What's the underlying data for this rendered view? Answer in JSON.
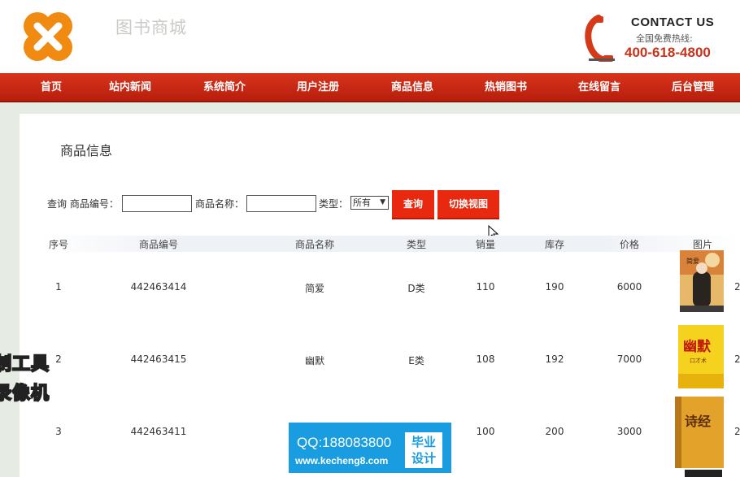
{
  "header": {
    "site_title": "图书商城",
    "contact_title": "CONTACT US",
    "contact_sub": "全国免费热线:",
    "contact_phone": "400-618-4800"
  },
  "nav": {
    "items": [
      "首页",
      "站内新闻",
      "系统简介",
      "用户注册",
      "商品信息",
      "热销图书",
      "在线留言",
      "后台管理"
    ]
  },
  "page": {
    "title": "商品信息"
  },
  "search": {
    "prefix_label": "查询 商品编号：",
    "code_value": "",
    "name_label": "商品名称：",
    "name_value": "",
    "type_label": "类型：",
    "type_selected": "所有",
    "query_button": "查询",
    "switch_button": "切换视图"
  },
  "table": {
    "columns": [
      "序号",
      "商品编号",
      "商品名称",
      "类型",
      "销量",
      "库存",
      "价格",
      "图片"
    ],
    "rows": [
      {
        "no": "1",
        "code": "442463414",
        "name": "简爱",
        "type": "D类",
        "sales": "110",
        "stock": "190",
        "price": "6000",
        "edge": "2"
      },
      {
        "no": "2",
        "code": "442463415",
        "name": "幽默",
        "type": "E类",
        "sales": "108",
        "stock": "192",
        "price": "7000",
        "edge": "2"
      },
      {
        "no": "3",
        "code": "442463411",
        "name": "",
        "type": "",
        "sales": "100",
        "stock": "200",
        "price": "3000",
        "edge": "2"
      }
    ]
  },
  "books": {
    "book1_title": "简爱",
    "book2_title": "幽默",
    "book2_sub": "口才术",
    "book3_title": "诗经"
  },
  "overlay": {
    "left_line1": "制工具",
    "left_line2": "录像机",
    "qq_text": "QQ:188083800",
    "qq_url": "www.kecheng8.com",
    "badge_line1": "毕业",
    "badge_line2": "设计"
  },
  "colors": {
    "nav_red": "#d8341c",
    "button_red": "#e8290f",
    "phone_orange": "#c8321a",
    "banner_blue": "#1a9de0"
  }
}
